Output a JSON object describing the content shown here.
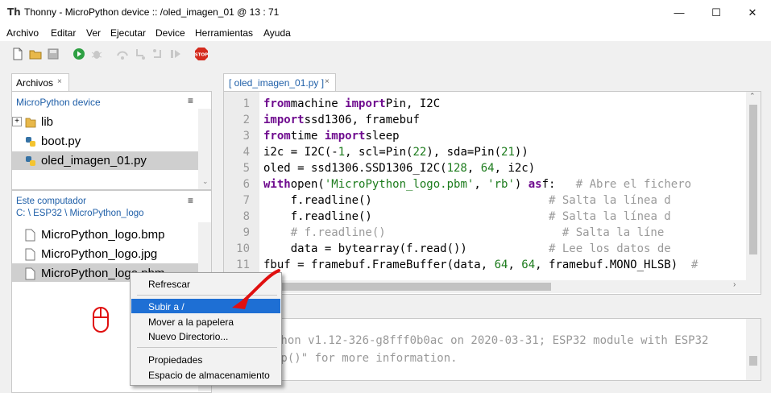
{
  "window": {
    "title": "Thonny  -  MicroPython device :: /oled_imagen_01  @  13 : 71",
    "app_icon": "Th",
    "minimize": "—",
    "maximize": "☐",
    "close": "✕"
  },
  "menubar": [
    "Archivo",
    "Editar",
    "Ver",
    "Ejecutar",
    "Device",
    "Herramientas",
    "Ayuda"
  ],
  "toolbar": {
    "icons": [
      "new-file-icon",
      "open-folder-icon",
      "save-icon",
      "run-icon",
      "debug-icon",
      "step-over-icon",
      "step-into-icon",
      "step-out-icon",
      "resume-icon",
      "stop-icon"
    ],
    "stop_label": "STOP"
  },
  "files_panel": {
    "tab_label": "Archivos",
    "tab_close": "×",
    "device": {
      "header": "MicroPython device",
      "menu": "≡",
      "items": [
        {
          "label": "lib",
          "type": "folder",
          "expander": "+"
        },
        {
          "label": "boot.py",
          "type": "python"
        },
        {
          "label": "oled_imagen_01.py",
          "type": "python",
          "selected": true
        }
      ]
    },
    "computer": {
      "header": "Este computador",
      "path": "C: \\ ESP32 \\ MicroPython_logo",
      "menu": "≡",
      "items": [
        {
          "label": "MicroPython_logo.bmp"
        },
        {
          "label": "MicroPython_logo.jpg"
        },
        {
          "label": "MicroPython_logo.pbm",
          "selected": true
        }
      ]
    }
  },
  "editor": {
    "tab_label": "[ oled_imagen_01.py ]",
    "tab_close": "×",
    "line_numbers": [
      "1",
      "2",
      "3",
      "4",
      "5",
      "6",
      "7",
      "8",
      "9",
      "10",
      "11"
    ],
    "lines": [
      [
        [
          "kw",
          "from"
        ],
        [
          "",
          "machine "
        ],
        [
          "kw",
          "import"
        ],
        [
          "",
          "Pin, I2C"
        ]
      ],
      [
        [
          "kw",
          "import"
        ],
        [
          "",
          "ssd1306, framebuf"
        ]
      ],
      [
        [
          "kw",
          "from"
        ],
        [
          "",
          "time "
        ],
        [
          "kw",
          "import"
        ],
        [
          "",
          "sleep"
        ]
      ],
      [
        [
          "",
          "i2c = I2C(-"
        ],
        [
          "num",
          "1"
        ],
        [
          "",
          ", scl=Pin("
        ],
        [
          "num",
          "22"
        ],
        [
          "",
          "), sda=Pin("
        ],
        [
          "num",
          "21"
        ],
        [
          "",
          "))"
        ]
      ],
      [
        [
          "",
          "oled = ssd1306.SSD1306_I2C("
        ],
        [
          "num",
          "128"
        ],
        [
          "",
          ", "
        ],
        [
          "num",
          "64"
        ],
        [
          "",
          ", i2c)"
        ]
      ],
      [
        [
          "kw",
          "with"
        ],
        [
          "",
          "open("
        ],
        [
          "str",
          "'MicroPython_logo.pbm'"
        ],
        [
          "",
          ", "
        ],
        [
          "str",
          "'rb'"
        ],
        [
          "",
          ") "
        ],
        [
          "kw",
          "as"
        ],
        [
          "",
          "f:   "
        ],
        [
          "cmt",
          "# Abre el fichero"
        ]
      ],
      [
        [
          "",
          "    f.readline()                          "
        ],
        [
          "cmt",
          "# Salta la línea d"
        ]
      ],
      [
        [
          "",
          "    f.readline()                          "
        ],
        [
          "cmt",
          "# Salta la línea d"
        ]
      ],
      [
        [
          "cmt",
          "    # f.readline()                          # Salta la líne"
        ]
      ],
      [
        [
          "",
          "    data = bytearray(f.read())            "
        ],
        [
          "cmt",
          "# Lee los datos de"
        ]
      ],
      [
        [
          "",
          "fbuf = framebuf.FrameBuffer(data, "
        ],
        [
          "num",
          "64"
        ],
        [
          "",
          ", "
        ],
        [
          "num",
          "64"
        ],
        [
          "",
          ", framebuf.MONO_HLSB)  "
        ],
        [
          "cmt",
          "#"
        ]
      ]
    ]
  },
  "shell": {
    "lines": [
      "thon v1.12-326-g8fff0b0ac on 2020-03-31; ESP32 module with ESP32",
      "lp()\" for more information."
    ]
  },
  "context_menu": {
    "items": [
      "Refrescar",
      "Subir a /",
      "Mover a la papelera",
      "Nuevo Directorio...",
      "Propiedades",
      "Espacio de almacenamiento"
    ],
    "highlighted": "Subir a /"
  },
  "colors": {
    "accent": "#1e6fd4",
    "header_blue": "#1f5fa8",
    "keyword": "#6e0a8e",
    "string": "#1d7c1d",
    "annotation_red": "#e01010"
  }
}
